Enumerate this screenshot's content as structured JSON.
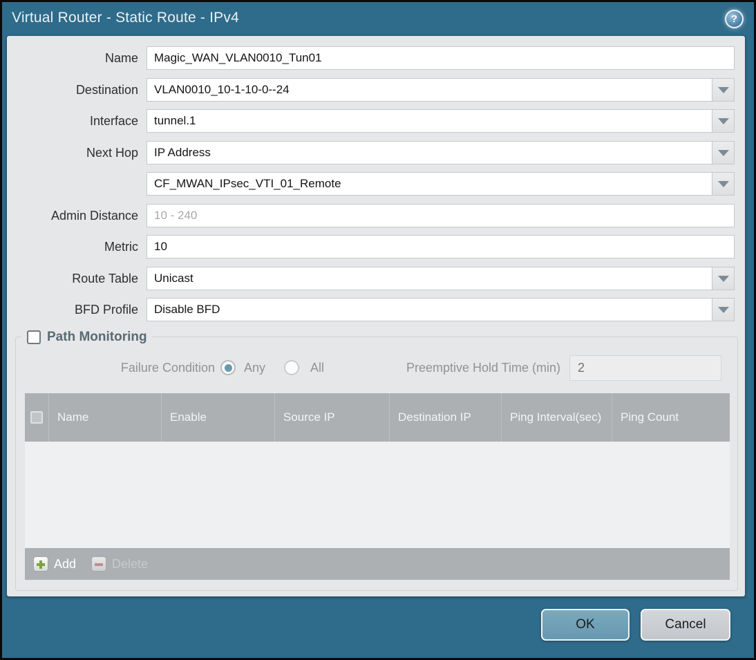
{
  "window": {
    "title": "Virtual Router - Static Route - IPv4",
    "ok_label": "OK",
    "cancel_label": "Cancel",
    "help_icon": "?"
  },
  "colors": {
    "titlebar": "#2f6b8a",
    "panel": "#e6e7e8",
    "table_header": "#acb0b3",
    "table_body": "#eff0f1",
    "ok_button": "#6699b0",
    "cancel_button": "#c3c7cc",
    "add_icon_green": "#7fa33e",
    "delete_icon_red": "#c4807e",
    "radio_dot": "#6b99ac"
  },
  "form": {
    "fields": [
      {
        "label": "Name",
        "value": "Magic_WAN_VLAN0010_Tun01",
        "type": "text"
      },
      {
        "label": "Destination",
        "value": "VLAN0010_10-1-10-0--24",
        "type": "dropdown"
      },
      {
        "label": "Interface",
        "value": "tunnel.1",
        "type": "dropdown"
      },
      {
        "label": "Next Hop",
        "value": "IP Address",
        "type": "dropdown"
      },
      {
        "label": "",
        "value": "CF_MWAN_IPsec_VTI_01_Remote",
        "type": "dropdown"
      },
      {
        "label": "Admin Distance",
        "value": "",
        "placeholder": "10 - 240",
        "type": "text"
      },
      {
        "label": "Metric",
        "value": "10",
        "type": "text"
      },
      {
        "label": "Route Table",
        "value": "Unicast",
        "type": "dropdown"
      },
      {
        "label": "BFD Profile",
        "value": "Disable BFD",
        "type": "dropdown"
      }
    ]
  },
  "path_monitoring": {
    "title": "Path Monitoring",
    "checked": false,
    "failure_condition_label": "Failure Condition",
    "options": [
      {
        "label": "Any",
        "selected": true
      },
      {
        "label": "All",
        "selected": false
      }
    ],
    "hold_time_label": "Preemptive Hold Time (min)",
    "hold_time_value": "2",
    "table": {
      "columns": [
        "Name",
        "Enable",
        "Source IP",
        "Destination IP",
        "Ping Interval(sec)",
        "Ping Count"
      ],
      "rows": [],
      "add_label": "Add",
      "delete_label": "Delete"
    }
  }
}
